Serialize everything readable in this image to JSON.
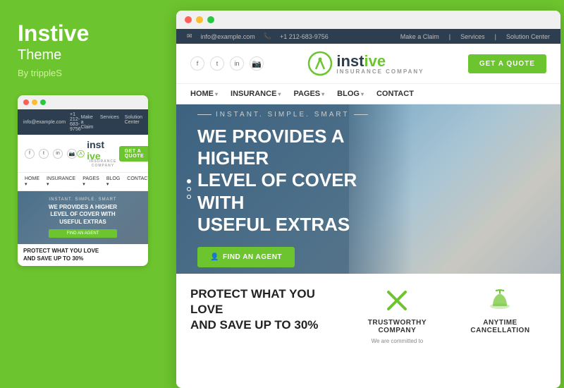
{
  "left": {
    "title": "Instive",
    "subtitle": "Theme",
    "by": "By trippleS"
  },
  "mini": {
    "titlebar_dots": [
      "red",
      "yellow",
      "green"
    ],
    "topbar": {
      "email": "info@example.com",
      "phone": "+1 212-683-9756",
      "links": [
        "Make a Claim",
        "Services",
        "Solution Center"
      ]
    },
    "logo_text_dark": "inst",
    "logo_text_green": "ive",
    "logo_sub": "INSURANCE COMPANY",
    "quote_btn": "GET A QUOTE",
    "nav_items": [
      "HOME",
      "INSURANCE",
      "PAGES",
      "BLOG",
      "CONTACT"
    ],
    "hero_tagline": "INSTANT. SIMPLE. SMART",
    "hero_title": "WE PROVIDES A HIGHER LEVEL OF COVER WITH USEFUL EXTRAS",
    "find_btn": "FIND AN AGENT",
    "bottom_title": "PROTECT WHAT YOU LOVE AND SAVE UP TO 30%"
  },
  "main": {
    "titlebar_dots": [
      "red",
      "yellow",
      "green"
    ],
    "topbar": {
      "email": "info@example.com",
      "phone": "+1 212-683-9756",
      "links": [
        "Make a Claim",
        "Services",
        "Solution Center"
      ]
    },
    "header": {
      "social_icons": [
        "f",
        "t",
        "in",
        "📷"
      ],
      "logo_dark": "inst",
      "logo_green": "ive",
      "logo_sub": "INSURANCE COMPANY",
      "quote_btn": "GET A QUOTE"
    },
    "nav": {
      "items": [
        {
          "label": "HOME",
          "has_arrow": true
        },
        {
          "label": "INSURANCE",
          "has_arrow": true
        },
        {
          "label": "PAGES",
          "has_arrow": true
        },
        {
          "label": "BLOG",
          "has_arrow": true
        },
        {
          "label": "CONTACT",
          "has_arrow": false
        }
      ]
    },
    "hero": {
      "tagline": "INSTANT. SIMPLE. SMART",
      "title_line1": "WE PROVIDES A HIGHER",
      "title_line2": "LEVEL OF COVER WITH",
      "title_line3": "USEFUL EXTRAS",
      "find_btn": "FIND AN AGENT"
    },
    "bottom": {
      "protect_title_line1": "PROTECT WHAT YOU LOVE",
      "protect_title_line2": "AND SAVE UP TO 30%",
      "cards": [
        {
          "icon": "x-cross",
          "title": "TRUSTWORTHY COMPANY",
          "desc": "We are committed to"
        },
        {
          "icon": "umbrella",
          "title": "ANYTIME CANCELLATION",
          "desc": ""
        }
      ]
    }
  }
}
